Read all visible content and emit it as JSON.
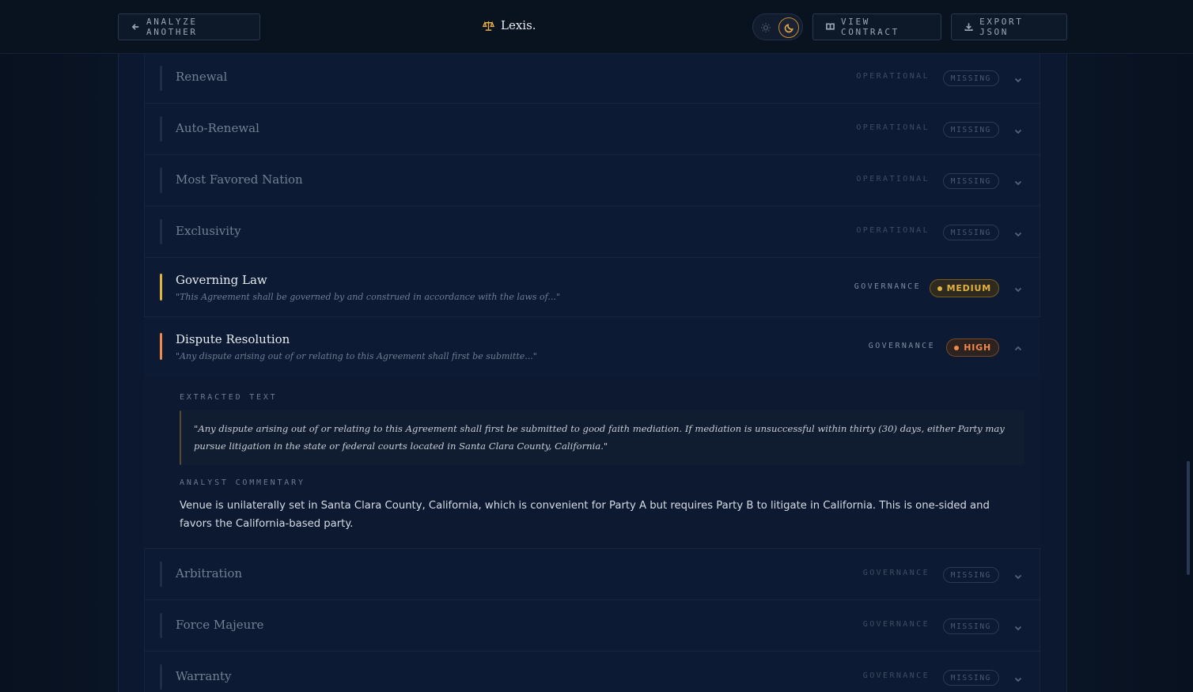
{
  "header": {
    "back_label": "ANALYZE ANOTHER",
    "brand": "Lexis.",
    "view_label": "VIEW CONTRACT",
    "export_label": "EXPORT JSON",
    "theme": "dark"
  },
  "clauses": [
    {
      "title": "Renewal",
      "category": "OPERATIONAL",
      "status": "MISSING"
    },
    {
      "title": "Auto-Renewal",
      "category": "OPERATIONAL",
      "status": "MISSING"
    },
    {
      "title": "Most Favored Nation",
      "category": "OPERATIONAL",
      "status": "MISSING"
    },
    {
      "title": "Exclusivity",
      "category": "OPERATIONAL",
      "status": "MISSING"
    },
    {
      "title": "Governing Law",
      "category": "GOVERNANCE",
      "status": "MEDIUM",
      "quote": "\"This Agreement shall be governed by and construed in accordance with the laws of...\""
    },
    {
      "title": "Dispute Resolution",
      "category": "GOVERNANCE",
      "status": "HIGH",
      "quote": "\"Any dispute arising out of or relating to this Agreement shall first be submitte...\""
    },
    {
      "title": "Arbitration",
      "category": "GOVERNANCE",
      "status": "MISSING"
    },
    {
      "title": "Force Majeure",
      "category": "GOVERNANCE",
      "status": "MISSING"
    },
    {
      "title": "Warranty",
      "category": "GOVERNANCE",
      "status": "MISSING"
    }
  ],
  "expanded": {
    "extracted_label": "EXTRACTED TEXT",
    "extracted_text": "\"Any dispute arising out of or relating to this Agreement shall first be submitted to good faith mediation. If mediation is unsuccessful within thirty (30) days, either Party may pursue litigation in the state or federal courts located in Santa Clara County, California.\"",
    "commentary_label": "ANALYST COMMENTARY",
    "commentary_text": "Venue is unilaterally set in Santa Clara County, California, which is convenient for Party A but requires Party B to litigate in California. This is one-sided and favors the California-based party."
  },
  "colors": {
    "medium": "#e3b341",
    "high": "#f0894a",
    "accent": "#e0a94a"
  }
}
